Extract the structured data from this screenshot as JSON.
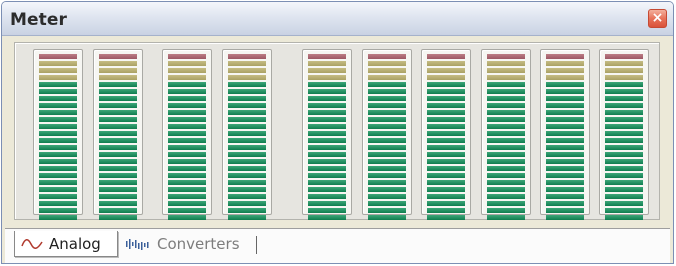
{
  "window": {
    "title": "Meter",
    "close_glyph": "×",
    "close_icon": "close-icon"
  },
  "meters": {
    "channel_count": 10,
    "segments_per_channel": 24,
    "segment_colors": {
      "red": "#a0606b",
      "yellow": "#b0a86c",
      "green": "#137f52"
    },
    "zones_top_to_bottom": [
      "red",
      "yellow",
      "yellow",
      "yellow",
      "green"
    ],
    "groups": [
      {
        "name": "group-1",
        "channels": 2
      },
      {
        "name": "group-2",
        "channels": 2
      },
      {
        "name": "group-3",
        "channels": 6
      }
    ]
  },
  "tabs": [
    {
      "label": "Analog",
      "icon": "sine-wave-icon",
      "active": true
    },
    {
      "label": "Converters",
      "icon": "waveform-icon",
      "active": false
    }
  ]
}
